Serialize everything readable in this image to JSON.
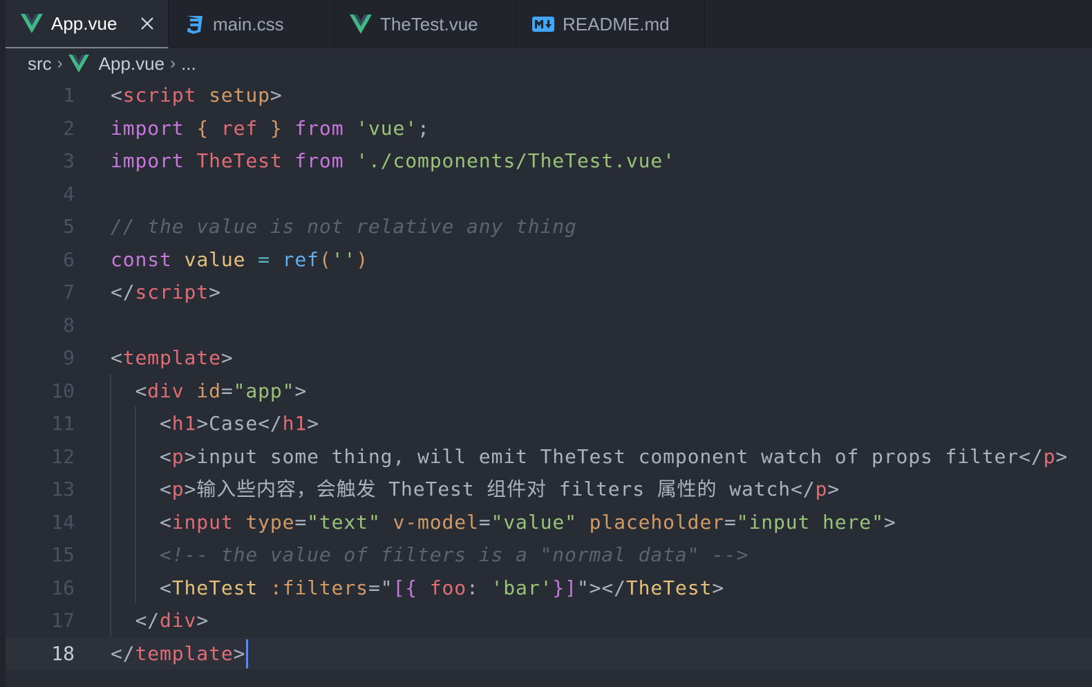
{
  "tabs": [
    {
      "label": "App.vue",
      "icon": "vue-icon",
      "active": true
    },
    {
      "label": "main.css",
      "icon": "css-icon",
      "active": false
    },
    {
      "label": "TheTest.vue",
      "icon": "vue-icon",
      "active": false
    },
    {
      "label": "README.md",
      "icon": "markdown-icon",
      "active": false
    }
  ],
  "breadcrumb": {
    "folder": "src",
    "file": "App.vue",
    "more": "..."
  },
  "editor": {
    "current_line": 18,
    "line_numbers": [
      "1",
      "2",
      "3",
      "4",
      "5",
      "6",
      "7",
      "8",
      "9",
      "10",
      "11",
      "12",
      "13",
      "14",
      "15",
      "16",
      "17",
      "18"
    ],
    "lines": [
      [
        {
          "t": "<",
          "c": "pl"
        },
        {
          "t": "script",
          "c": "tag"
        },
        {
          "t": " ",
          "c": "pl"
        },
        {
          "t": "setup",
          "c": "attr"
        },
        {
          "t": ">",
          "c": "pl"
        }
      ],
      [
        {
          "t": "import",
          "c": "kw"
        },
        {
          "t": " ",
          "c": "pl"
        },
        {
          "t": "{",
          "c": "attr"
        },
        {
          "t": " ",
          "c": "pl"
        },
        {
          "t": "ref",
          "c": "tag"
        },
        {
          "t": " ",
          "c": "pl"
        },
        {
          "t": "}",
          "c": "attr"
        },
        {
          "t": " ",
          "c": "pl"
        },
        {
          "t": "from",
          "c": "kw"
        },
        {
          "t": " ",
          "c": "pl"
        },
        {
          "t": "'vue'",
          "c": "str"
        },
        {
          "t": ";",
          "c": "pl"
        }
      ],
      [
        {
          "t": "import",
          "c": "kw"
        },
        {
          "t": " ",
          "c": "pl"
        },
        {
          "t": "TheTest",
          "c": "tag"
        },
        {
          "t": " ",
          "c": "pl"
        },
        {
          "t": "from",
          "c": "kw"
        },
        {
          "t": " ",
          "c": "pl"
        },
        {
          "t": "'./components/TheTest.vue'",
          "c": "str"
        }
      ],
      [],
      [
        {
          "t": "// the value is not relative any thing",
          "c": "cm"
        }
      ],
      [
        {
          "t": "const",
          "c": "kw"
        },
        {
          "t": " ",
          "c": "pl"
        },
        {
          "t": "value",
          "c": "var"
        },
        {
          "t": " ",
          "c": "pl"
        },
        {
          "t": "=",
          "c": "op"
        },
        {
          "t": " ",
          "c": "pl"
        },
        {
          "t": "ref",
          "c": "fn"
        },
        {
          "t": "(",
          "c": "attr"
        },
        {
          "t": "''",
          "c": "str"
        },
        {
          "t": ")",
          "c": "attr"
        }
      ],
      [
        {
          "t": "</",
          "c": "pl"
        },
        {
          "t": "script",
          "c": "tag"
        },
        {
          "t": ">",
          "c": "pl"
        }
      ],
      [],
      [
        {
          "t": "<",
          "c": "pl"
        },
        {
          "t": "template",
          "c": "tag"
        },
        {
          "t": ">",
          "c": "pl"
        }
      ],
      [
        {
          "t": "  <",
          "c": "pl"
        },
        {
          "t": "div",
          "c": "tag"
        },
        {
          "t": " ",
          "c": "pl"
        },
        {
          "t": "id",
          "c": "attr"
        },
        {
          "t": "=",
          "c": "pl"
        },
        {
          "t": "\"app\"",
          "c": "str"
        },
        {
          "t": ">",
          "c": "pl"
        }
      ],
      [
        {
          "t": "    <",
          "c": "pl"
        },
        {
          "t": "h1",
          "c": "tag"
        },
        {
          "t": ">Case</",
          "c": "pl"
        },
        {
          "t": "h1",
          "c": "tag"
        },
        {
          "t": ">",
          "c": "pl"
        }
      ],
      [
        {
          "t": "    <",
          "c": "pl"
        },
        {
          "t": "p",
          "c": "tag"
        },
        {
          "t": ">input some thing, will emit TheTest component watch of props filter</",
          "c": "pl"
        },
        {
          "t": "p",
          "c": "tag"
        },
        {
          "t": ">",
          "c": "pl"
        }
      ],
      [
        {
          "t": "    <",
          "c": "pl"
        },
        {
          "t": "p",
          "c": "tag"
        },
        {
          "t": ">输入些内容，会触发 TheTest 组件对 filters 属性的 watch</",
          "c": "pl"
        },
        {
          "t": "p",
          "c": "tag"
        },
        {
          "t": ">",
          "c": "pl"
        }
      ],
      [
        {
          "t": "    <",
          "c": "pl"
        },
        {
          "t": "input",
          "c": "tag"
        },
        {
          "t": " ",
          "c": "pl"
        },
        {
          "t": "type",
          "c": "attr"
        },
        {
          "t": "=",
          "c": "pl"
        },
        {
          "t": "\"text\"",
          "c": "str"
        },
        {
          "t": " ",
          "c": "pl"
        },
        {
          "t": "v-model",
          "c": "attr"
        },
        {
          "t": "=",
          "c": "pl"
        },
        {
          "t": "\"value\"",
          "c": "str"
        },
        {
          "t": " ",
          "c": "pl"
        },
        {
          "t": "placeholder",
          "c": "attr"
        },
        {
          "t": "=",
          "c": "pl"
        },
        {
          "t": "\"input here\"",
          "c": "str"
        },
        {
          "t": ">",
          "c": "pl"
        }
      ],
      [
        {
          "t": "    <!-- the value of filters is a \"normal data\" -->",
          "c": "cm"
        }
      ],
      [
        {
          "t": "    <",
          "c": "pl"
        },
        {
          "t": "TheTest",
          "c": "var"
        },
        {
          "t": " ",
          "c": "pl"
        },
        {
          "t": ":filters",
          "c": "attr"
        },
        {
          "t": "=",
          "c": "pl"
        },
        {
          "t": "\"",
          "c": "pl"
        },
        {
          "t": "[{",
          "c": "kw"
        },
        {
          "t": " ",
          "c": "pl"
        },
        {
          "t": "foo",
          "c": "tag"
        },
        {
          "t": ": ",
          "c": "pl"
        },
        {
          "t": "'bar'",
          "c": "str"
        },
        {
          "t": "}]",
          "c": "kw"
        },
        {
          "t": "\"",
          "c": "pl"
        },
        {
          "t": "></",
          "c": "pl"
        },
        {
          "t": "TheTest",
          "c": "var"
        },
        {
          "t": ">",
          "c": "pl"
        }
      ],
      [
        {
          "t": "  </",
          "c": "pl"
        },
        {
          "t": "div",
          "c": "tag"
        },
        {
          "t": ">",
          "c": "pl"
        }
      ],
      [
        {
          "t": "</",
          "c": "pl"
        },
        {
          "t": "template",
          "c": "tag"
        },
        {
          "t": ">",
          "c": "pl"
        }
      ]
    ]
  },
  "colors": {
    "background": "#282c34",
    "tabbar": "#21252b",
    "vue_green": "#42b883",
    "css_blue": "#42a5f5",
    "markdown_blue": "#42a5f5",
    "cursor": "#528bff"
  }
}
